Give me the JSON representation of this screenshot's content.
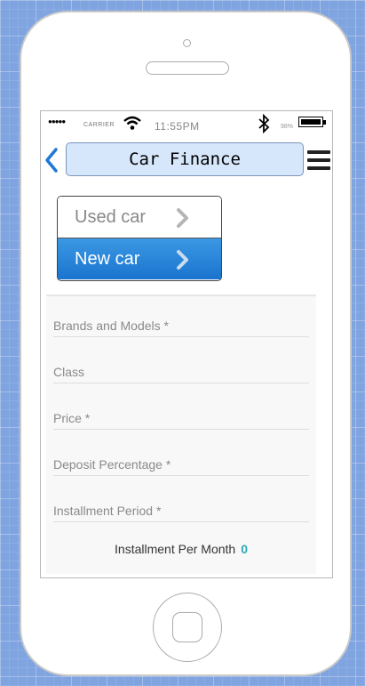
{
  "status_bar": {
    "signal": "●●●●●",
    "carrier": "CARRIER",
    "time": "11:55PM",
    "battery": "98%",
    "battery_level": 0.98
  },
  "header": {
    "title": "Car Finance",
    "back_icon": "chevron-left-icon",
    "menu_icon": "hamburger-menu-icon"
  },
  "segment": {
    "options": [
      {
        "label": "Used car",
        "selected": false
      },
      {
        "label": "New car",
        "selected": true
      }
    ]
  },
  "form": {
    "fields": [
      {
        "label": "Brands and Models *"
      },
      {
        "label": "Class"
      },
      {
        "label": "Price *"
      },
      {
        "label": "Deposit Percentage *"
      },
      {
        "label": "Installment Period *"
      }
    ],
    "result_label": "Installment Per Month",
    "result_value": "0"
  },
  "colors": {
    "accent": "#1a74cf",
    "title_bg": "#d6e6fb",
    "result_value": "#2ea8b8",
    "background": "#7fa4e0"
  }
}
